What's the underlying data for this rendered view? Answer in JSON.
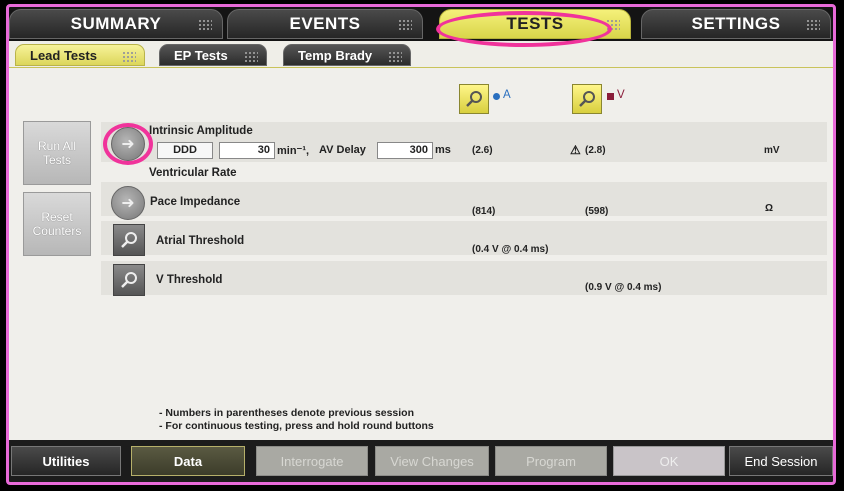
{
  "main_tabs": [
    "SUMMARY",
    "EVENTS",
    "TESTS",
    "SETTINGS"
  ],
  "sub_tabs": [
    "Lead Tests",
    "EP Tests",
    "Temp Brady"
  ],
  "side_buttons": {
    "run_all": "Run All Tests",
    "reset": "Reset Counters"
  },
  "columns": {
    "atrial": "A",
    "ventricular": "V"
  },
  "intrinsic": {
    "label": "Intrinsic Amplitude",
    "mode": "DDD",
    "rate": "30",
    "rate_unit": "min⁻¹,",
    "av_label": "AV Delay",
    "av_value": "300",
    "av_unit": "ms",
    "a_value": "(2.6)",
    "v_value": "(2.8)",
    "unit": "mV",
    "sub_label": "Ventricular Rate"
  },
  "pace_impedance": {
    "label": "Pace Impedance",
    "a_value": "(814)",
    "v_value": "(598)",
    "unit": "Ω"
  },
  "atrial_threshold": {
    "label": "Atrial Threshold",
    "a_value": "(0.4 V @ 0.4 ms)"
  },
  "v_threshold": {
    "label": "V Threshold",
    "v_value": "(0.9 V @ 0.4 ms)"
  },
  "notes": [
    "- Numbers in parentheses denote previous session",
    "- For continuous testing, press and hold round buttons"
  ],
  "bottom_buttons": {
    "utilities": "Utilities",
    "data": "Data",
    "interrogate": "Interrogate",
    "view_changes": "View Changes",
    "program": "Program",
    "ok": "OK",
    "end_session": "End Session"
  },
  "colors": {
    "active_tab": "#e6e05a",
    "highlight": "#f0339b",
    "atrial_dot": "#2a6fbf",
    "ventricular_square": "#8a1c3a"
  }
}
